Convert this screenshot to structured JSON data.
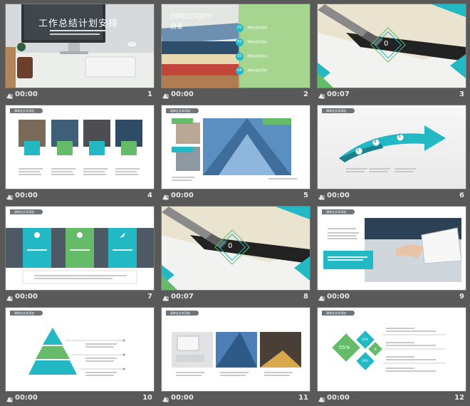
{
  "colors": {
    "teal": "#22b8c4",
    "green": "#66bb6a",
    "background": "#595959",
    "label": "#e8e8e8"
  },
  "tag_text": "请单击文本添加",
  "slides": [
    {
      "number": "1",
      "time": "00:00",
      "title": "工作总结计划安排",
      "subtitle": ""
    },
    {
      "number": "2",
      "time": "00:00",
      "heading_en": "DIRECTORY",
      "heading_cn": "目录",
      "items": [
        {
          "num": "01",
          "text": "请单击此处添加"
        },
        {
          "num": "02",
          "text": "请单击此处添加"
        },
        {
          "num": "03",
          "text": "请单击此处添加"
        },
        {
          "num": "04",
          "text": "请单击此处添加"
        }
      ]
    },
    {
      "number": "3",
      "time": "00:07",
      "center_num": "0"
    },
    {
      "number": "4",
      "time": "00:00"
    },
    {
      "number": "5",
      "time": "00:00"
    },
    {
      "number": "6",
      "time": "00:00",
      "steps": [
        "1",
        "2",
        "3"
      ]
    },
    {
      "number": "7",
      "time": "00:00"
    },
    {
      "number": "8",
      "time": "00:07",
      "center_num": "0"
    },
    {
      "number": "9",
      "time": "00:00"
    },
    {
      "number": "10",
      "time": "00:00"
    },
    {
      "number": "11",
      "time": "00:00"
    },
    {
      "number": "12",
      "time": "00:00",
      "pct_big": "55%",
      "pct_small": "32%",
      "pct_mid": "%",
      "pct_low": "26%"
    }
  ]
}
